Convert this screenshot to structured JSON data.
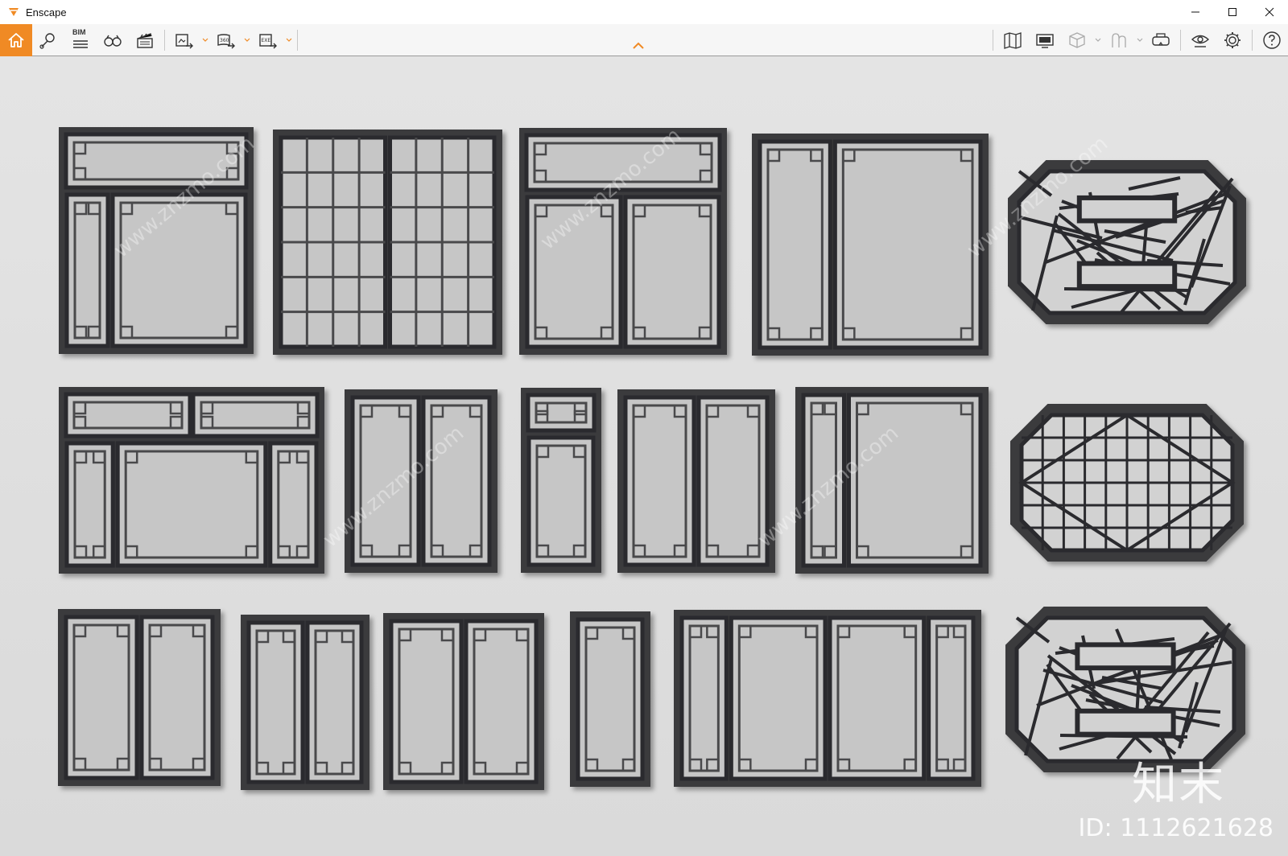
{
  "window": {
    "title": "Enscape",
    "brand_color": "#f08a24"
  },
  "toolbar": {
    "left_icons": [
      "home-icon",
      "location-pin-icon",
      "bim-icon",
      "binoculars-icon",
      "clapperboard-icon",
      "screenshot-export-icon",
      "panorama-360-icon",
      "exe-export-icon"
    ],
    "bim_label": "BIM",
    "right_icons": [
      "map-icon",
      "monitor-icon",
      "cube-icon",
      "assets-icon",
      "vr-headset-icon",
      "visibility-icon",
      "settings-icon",
      "help-icon"
    ]
  },
  "watermark": {
    "logo_text": "知末",
    "id_text": "ID: 1112621628"
  }
}
